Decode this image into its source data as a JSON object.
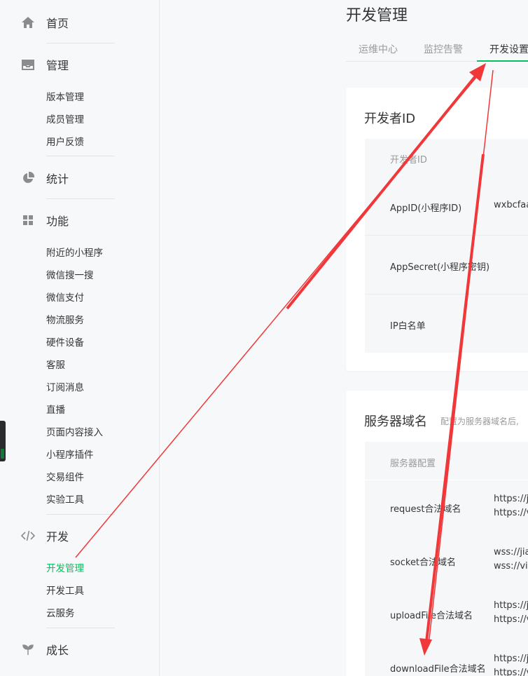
{
  "sidebar": {
    "home": "首页",
    "manage": {
      "label": "管理",
      "items": [
        "版本管理",
        "成员管理",
        "用户反馈"
      ]
    },
    "stats": "统计",
    "features": {
      "label": "功能",
      "items": [
        "附近的小程序",
        "微信搜一搜",
        "微信支付",
        "物流服务",
        "硬件设备",
        "客服",
        "订阅消息",
        "直播",
        "页面内容接入",
        "小程序插件",
        "交易组件",
        "实验工具"
      ]
    },
    "dev": {
      "label": "开发",
      "items": [
        "开发管理",
        "开发工具",
        "云服务"
      ]
    },
    "growth": "成长"
  },
  "main": {
    "title": "开发管理",
    "tabs": [
      "运维中心",
      "监控告警",
      "开发设置"
    ],
    "developer_card": {
      "title": "开发者ID",
      "table_head": "开发者ID",
      "rows": [
        {
          "label": "AppID(小程序ID)",
          "value": "wxbcfaa"
        },
        {
          "label": "AppSecret(小程序密钥)",
          "value": ""
        },
        {
          "label": "IP白名单",
          "value": ""
        }
      ]
    },
    "server_card": {
      "title": "服务器域名",
      "note": "配置为服务器域名后,",
      "table_head": "服务器配置",
      "rows": [
        {
          "label": "request合法域名",
          "values": [
            "https://ji",
            "https://v"
          ]
        },
        {
          "label": "socket合法域名",
          "values": [
            "wss://jia",
            "wss://vip"
          ]
        },
        {
          "label": "uploadFile合法域名",
          "values": [
            "https://ji",
            "https://v"
          ]
        },
        {
          "label": "downloadFile合法域名",
          "values": [
            "https://ji",
            "https://v"
          ]
        }
      ]
    }
  },
  "colors": {
    "accent": "#07c160",
    "annotation": "#f0373a"
  }
}
